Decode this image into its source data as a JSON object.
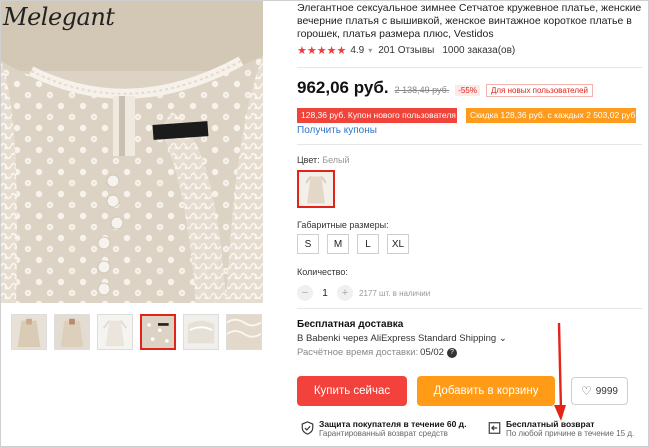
{
  "brand": "Melegant",
  "product": {
    "title": "Элегантное сексуальное зимнее Сетчатое кружевное платье, женские вечерние платья с вышивкой, женское винтажное короткое платье в горошек, платья размера плюс, Vestidos",
    "stars": "★★★★★",
    "rating": "4.9",
    "reviews": "201 Отзывы",
    "orders": "1000 заказа(ов)"
  },
  "price": {
    "current": "962,06 руб.",
    "old": "2 138,49 руб.",
    "discount": "-55%",
    "new_user_badge": "Для новых пользователей"
  },
  "coupons": {
    "new_user": "128,36 руб. Купон нового пользователя",
    "discount": "Скидка 128,36 руб. с каждых 2 503,02 руб.",
    "get_link": "Получить купоны"
  },
  "color": {
    "label": "Цвет:",
    "value": "Белый"
  },
  "sizes": {
    "label": "Габаритные размеры:",
    "options": [
      "S",
      "M",
      "L",
      "XL"
    ]
  },
  "quantity": {
    "label": "Количество:",
    "minus": "−",
    "value": "1",
    "plus": "+",
    "stock": "2177 шт. в наличии"
  },
  "shipping": {
    "title": "Бесплатная доставка",
    "method": "В Babenki через AliExpress Standard Shipping",
    "chevron": "⌄",
    "date_label": "Расчётное время доставки:",
    "date_value": "05/02",
    "help": "?"
  },
  "actions": {
    "buy": "Купить сейчас",
    "cart": "Добавить в корзину",
    "wish_icon": "♡",
    "wish_count": "9999"
  },
  "guarantees": [
    {
      "title": "Защита покупателя в течение 60 д.",
      "sub": "Гарантированный возврат средств"
    },
    {
      "title": "Бесплатный возврат",
      "sub": "По любой причине в течение 15 д."
    }
  ],
  "colors": {
    "accent_red": "#f3413b",
    "accent_orange": "#ff9b16",
    "link_blue": "#2e75c9",
    "annotation_arrow": "#e2231a"
  }
}
